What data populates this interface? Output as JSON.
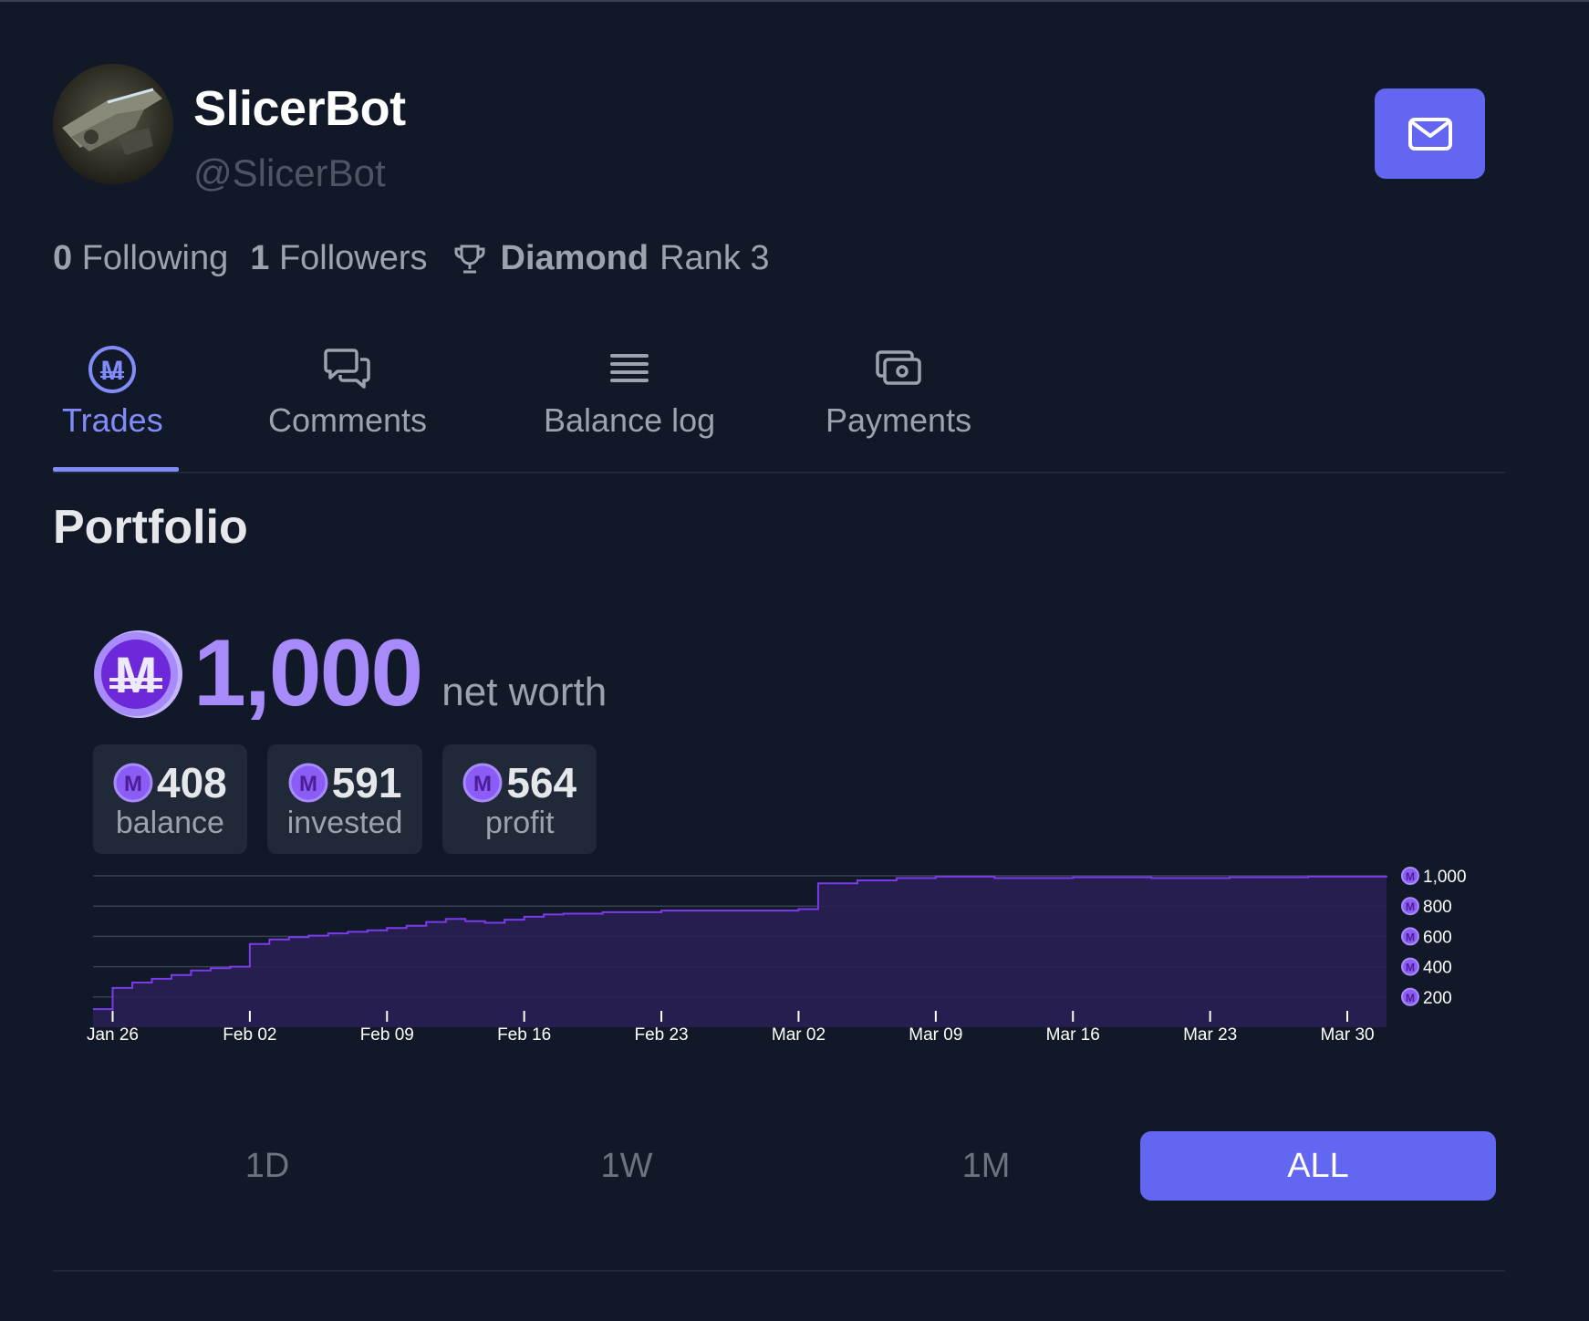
{
  "profile": {
    "name": "SlicerBot",
    "handle": "@SlicerBot",
    "following_count": "0",
    "following_label": "Following",
    "followers_count": "1",
    "followers_label": "Followers",
    "rank_tier": "Diamond",
    "rank_label": "Rank 3",
    "avatar": "avatar-image",
    "message_icon": "mail-icon"
  },
  "tabs": [
    {
      "label": "Trades",
      "icon": "mana-coin-icon",
      "active": true
    },
    {
      "label": "Comments",
      "icon": "chat-bubbles-icon",
      "active": false
    },
    {
      "label": "Balance log",
      "icon": "list-icon",
      "active": false
    },
    {
      "label": "Payments",
      "icon": "cash-icon",
      "active": false
    }
  ],
  "portfolio": {
    "title": "Portfolio",
    "net_worth": "1,000",
    "net_worth_label": "net worth",
    "cards": [
      {
        "value": "408",
        "label": "balance"
      },
      {
        "value": "591",
        "label": "invested"
      },
      {
        "value": "564",
        "label": "profit"
      }
    ]
  },
  "chart_data": {
    "type": "area",
    "title": "",
    "xlabel": "",
    "ylabel": "",
    "x_ticks": [
      "Jan 26",
      "Feb 02",
      "Feb 09",
      "Feb 16",
      "Feb 23",
      "Mar 02",
      "Mar 09",
      "Mar 16",
      "Mar 23",
      "Mar 30"
    ],
    "y_ticks": [
      "1,000",
      "800",
      "600",
      "400",
      "200"
    ],
    "ylim": [
      0,
      1000
    ],
    "y_axis_position": "right",
    "grid": true,
    "color": "#7c3aed",
    "series": [
      {
        "x": [
          "Jan 25",
          "Jan 26",
          "Jan 27",
          "Jan 28",
          "Jan 29",
          "Jan 30",
          "Jan 31",
          "Feb 01",
          "Feb 02",
          "Feb 03",
          "Feb 04",
          "Feb 05",
          "Feb 06",
          "Feb 07",
          "Feb 08",
          "Feb 09",
          "Feb 10",
          "Feb 11",
          "Feb 12",
          "Feb 13",
          "Feb 14",
          "Feb 15",
          "Feb 16",
          "Feb 17",
          "Feb 18",
          "Feb 20",
          "Feb 23",
          "Feb 26",
          "Feb 28",
          "Mar 01",
          "Mar 02",
          "Mar 03",
          "Mar 05",
          "Mar 07",
          "Mar 09",
          "Mar 12",
          "Mar 16",
          "Mar 20",
          "Mar 24",
          "Mar 28",
          "Mar 30",
          "Apr 01"
        ],
        "y": [
          120,
          260,
          295,
          320,
          345,
          375,
          390,
          400,
          550,
          580,
          595,
          605,
          620,
          630,
          640,
          655,
          670,
          695,
          715,
          700,
          690,
          710,
          730,
          745,
          750,
          760,
          770,
          770,
          770,
          770,
          780,
          950,
          970,
          985,
          995,
          985,
          990,
          985,
          990,
          995,
          995,
          1000
        ]
      }
    ]
  },
  "range_buttons": [
    {
      "label": "1D",
      "active": false
    },
    {
      "label": "1W",
      "active": false
    },
    {
      "label": "1M",
      "active": false
    },
    {
      "label": "ALL",
      "active": true
    }
  ],
  "colors": {
    "background": "#111827",
    "accent": "#6366f1",
    "purple": "#a78bfa",
    "muted": "#9ca3af"
  }
}
